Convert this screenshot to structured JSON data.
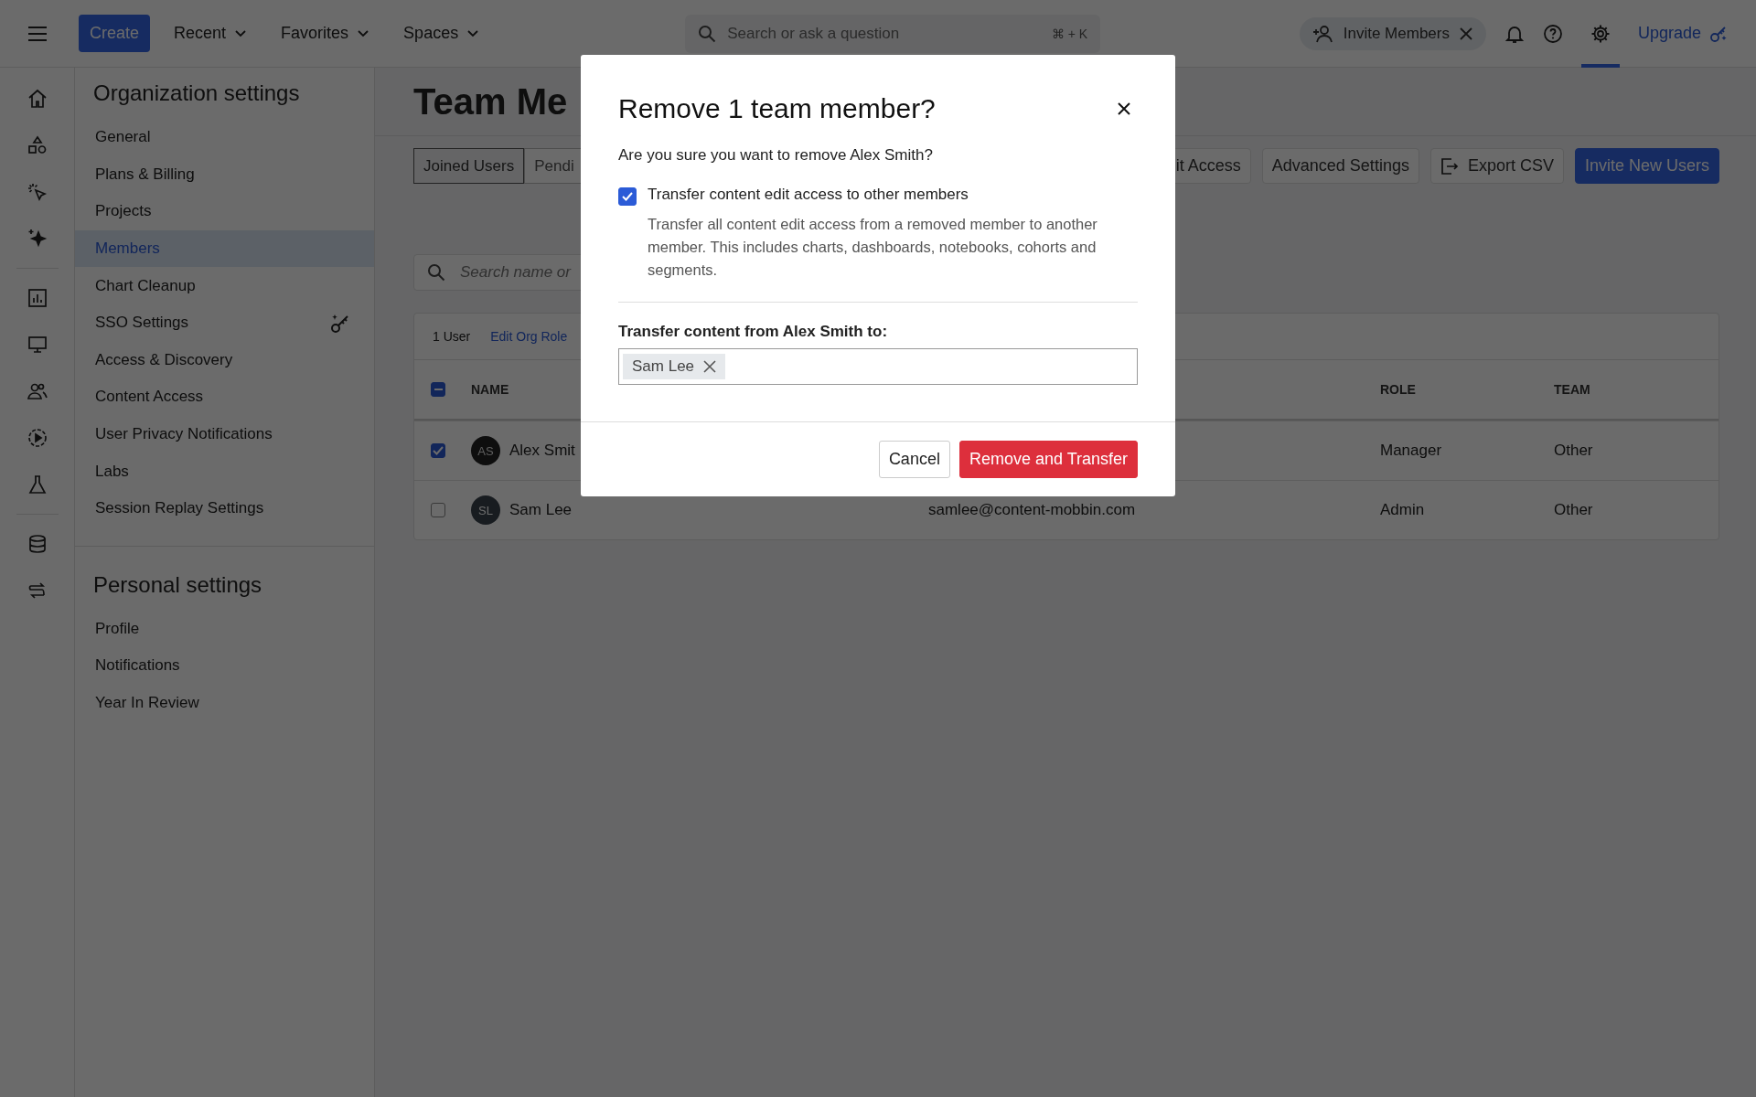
{
  "top_bar": {
    "create_button": "Create",
    "menus": [
      {
        "label": "Recent"
      },
      {
        "label": "Favorites"
      },
      {
        "label": "Spaces"
      }
    ],
    "search": {
      "placeholder": "Search or ask a question",
      "shortcut": "⌘ + K"
    },
    "invite_pill": "Invite Members",
    "actions": [
      {
        "kind": "bell",
        "selected": false
      },
      {
        "kind": "help",
        "selected": false
      },
      {
        "kind": "settings",
        "selected": true
      }
    ],
    "upgrade_link": "Upgrade"
  },
  "icon_rail": [
    [
      {
        "kind": "home"
      },
      {
        "kind": "shapes"
      },
      {
        "kind": "click"
      },
      {
        "kind": "sparkle"
      }
    ],
    [
      {
        "kind": "chart"
      },
      {
        "kind": "monitor"
      },
      {
        "kind": "people"
      },
      {
        "kind": "play"
      },
      {
        "kind": "flask"
      }
    ],
    [
      {
        "kind": "database"
      },
      {
        "kind": "swap"
      }
    ]
  ],
  "sidebar": {
    "sections": [
      {
        "title": "Organization settings",
        "items": [
          {
            "label": "General",
            "selected": false,
            "kind": "plain"
          },
          {
            "label": "Plans & Billing",
            "selected": false,
            "kind": "plain"
          },
          {
            "label": "Projects",
            "selected": false,
            "kind": "plain"
          },
          {
            "label": "Members",
            "selected": true,
            "kind": "plain"
          },
          {
            "label": "Chart Cleanup",
            "selected": false,
            "kind": "plain"
          },
          {
            "label": "SSO Settings",
            "selected": false,
            "kind": "premium"
          },
          {
            "label": "Access & Discovery",
            "selected": false,
            "kind": "plain"
          },
          {
            "label": "Content Access",
            "selected": false,
            "kind": "plain"
          },
          {
            "label": "User Privacy Notifications",
            "selected": false,
            "kind": "plain"
          },
          {
            "label": "Labs",
            "selected": false,
            "kind": "plain"
          },
          {
            "label": "Session Replay Settings",
            "selected": false,
            "kind": "plain"
          }
        ]
      },
      {
        "title": "Personal settings",
        "items": [
          {
            "label": "Profile",
            "selected": false,
            "kind": "plain"
          },
          {
            "label": "Notifications",
            "selected": false,
            "kind": "plain"
          },
          {
            "label": "Year In Review",
            "selected": false,
            "kind": "plain"
          }
        ]
      }
    ]
  },
  "page": {
    "title": "Team Me",
    "tabs": [
      {
        "label": "Joined Users",
        "selected": true
      },
      {
        "label": "Pendi",
        "selected": false
      }
    ],
    "actions": [
      {
        "label": "it Access",
        "kind": "plain"
      },
      {
        "label": "Advanced Settings",
        "kind": "plain"
      },
      {
        "label": "Export CSV",
        "kind": "export"
      },
      {
        "label": "Invite New Users",
        "kind": "primary"
      }
    ],
    "search": {
      "placeholder": "Search name or"
    },
    "table": {
      "selection_count": "1 User",
      "bulk_action": "Edit Org Role",
      "header_checkbox": {
        "indeterminate": true
      },
      "columns": [
        {
          "label": "NAME"
        },
        {
          "label": "ROLE"
        },
        {
          "label": "TEAM"
        }
      ],
      "rows": [
        {
          "checked": true,
          "initials": "AS",
          "name": "Alex Smit",
          "role": "Manager",
          "team": "Other"
        },
        {
          "checked": false,
          "initials": "SL",
          "name": "Sam Lee",
          "email": "samlee@content-mobbin.com",
          "role": "Admin",
          "team": "Other"
        }
      ]
    }
  },
  "dialog": {
    "title": "Remove 1 team member?",
    "message": "Are you sure you want to remove Alex Smith?",
    "transfer_option": {
      "checked": true,
      "label": "Transfer content edit access to other members",
      "description": "Transfer all content edit access from a removed member to another member. This includes charts, dashboards, notebooks, cohorts and segments."
    },
    "field_label": "Transfer content from Alex Smith to:",
    "recipients": [
      {
        "name": "Sam Lee"
      }
    ],
    "buttons": [
      {
        "label": "Cancel",
        "kind": "secondary"
      },
      {
        "label": "Remove and Transfer",
        "kind": "danger"
      }
    ]
  }
}
